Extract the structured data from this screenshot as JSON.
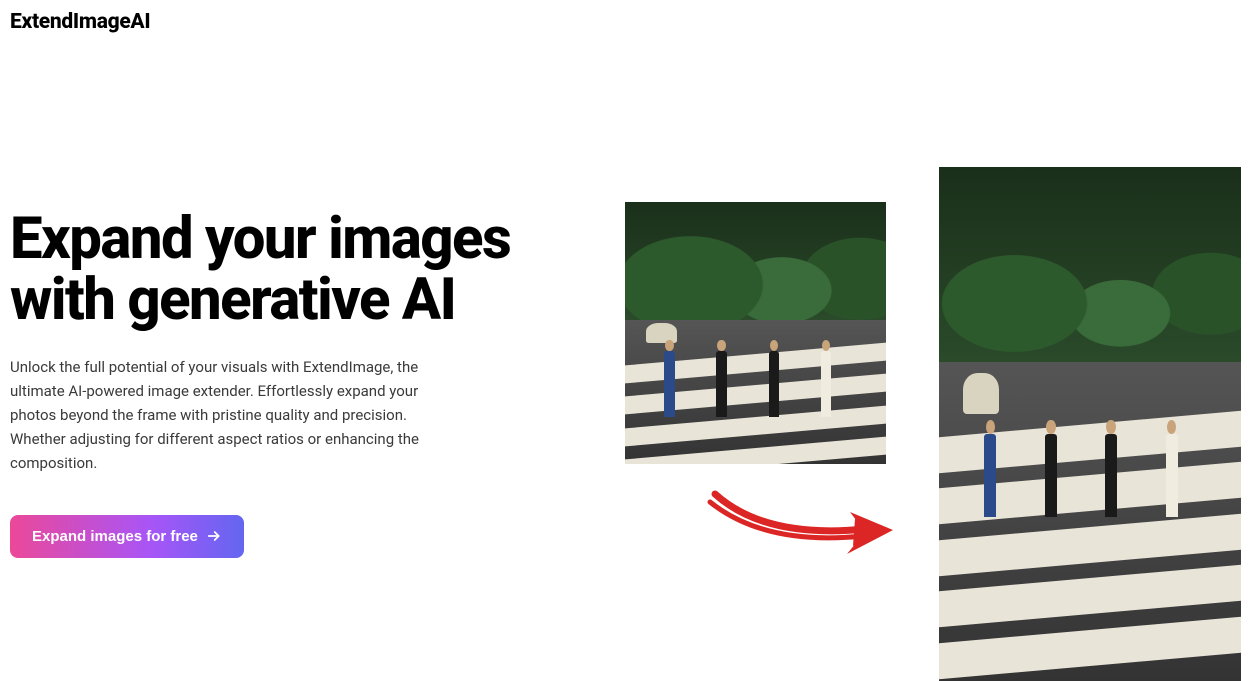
{
  "header": {
    "logo": "ExtendImageAI"
  },
  "hero": {
    "headline": "Expand your images with generative AI",
    "description": "Unlock the full potential of your visuals with ExtendImage, the ultimate AI-powered image extender. Effortlessly expand your photos beyond the frame with pristine quality and precision. Whether adjusting for different aspect ratios or enhancing the composition.",
    "cta_label": "Expand images for free"
  },
  "demo": {
    "before_alt": "original-image",
    "after_alt": "expanded-image",
    "arrow_alt": "arrow-pointing-to-result"
  },
  "colors": {
    "cta_gradient_from": "#ec4899",
    "cta_gradient_mid": "#a855f7",
    "cta_gradient_to": "#6366f1",
    "arrow": "#dc2626"
  }
}
